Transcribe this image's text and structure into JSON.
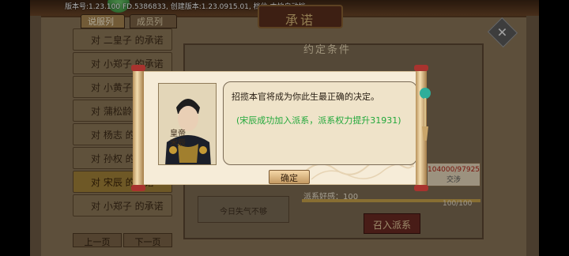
{
  "header": {
    "version_info": "版本号:1.23.100 FD.5386833, 创建版本:1.23.0915.01, 档位:本地自动档",
    "title": "承诺"
  },
  "tabs": [
    {
      "label": "说服列表"
    },
    {
      "label": "成员列表"
    }
  ],
  "left_list": {
    "items": [
      {
        "label": "对 二皇子 的承诺"
      },
      {
        "label": "对 小郑子 的承诺"
      },
      {
        "label": "对 小黄子 的承诺"
      },
      {
        "label": "对 蒲松龄 的承诺"
      },
      {
        "label": "对 杨志 的承诺"
      },
      {
        "label": "对 孙权 的承诺"
      },
      {
        "label": "对 宋辰 的承诺"
      },
      {
        "label": "对 小郑子 的承诺"
      }
    ],
    "prev_page": "上一页",
    "next_page": "下一页"
  },
  "right_panel": {
    "pact_title": "约定条件",
    "power_value": "104000/97925",
    "power_sub": "交涉",
    "favor_label": "派系好感：100",
    "favor_value": "100/100",
    "favor_fraction": 1.0,
    "notice": "今日失气不够",
    "recruit_button": "召入派系"
  },
  "dialog": {
    "portrait_name": "皇帝\n宋辰",
    "line1": "招揽本官将成为你此生最正确的决定。",
    "line2": "(宋辰成功加入派系，派系权力提升31931)",
    "confirm": "确定"
  },
  "colors": {
    "paper": "#f6ecd8",
    "success_text": "#21a83a",
    "panel_brown": "#8a7558"
  },
  "icons": {
    "close": "close-icon",
    "tassel": "tassel-icon"
  }
}
